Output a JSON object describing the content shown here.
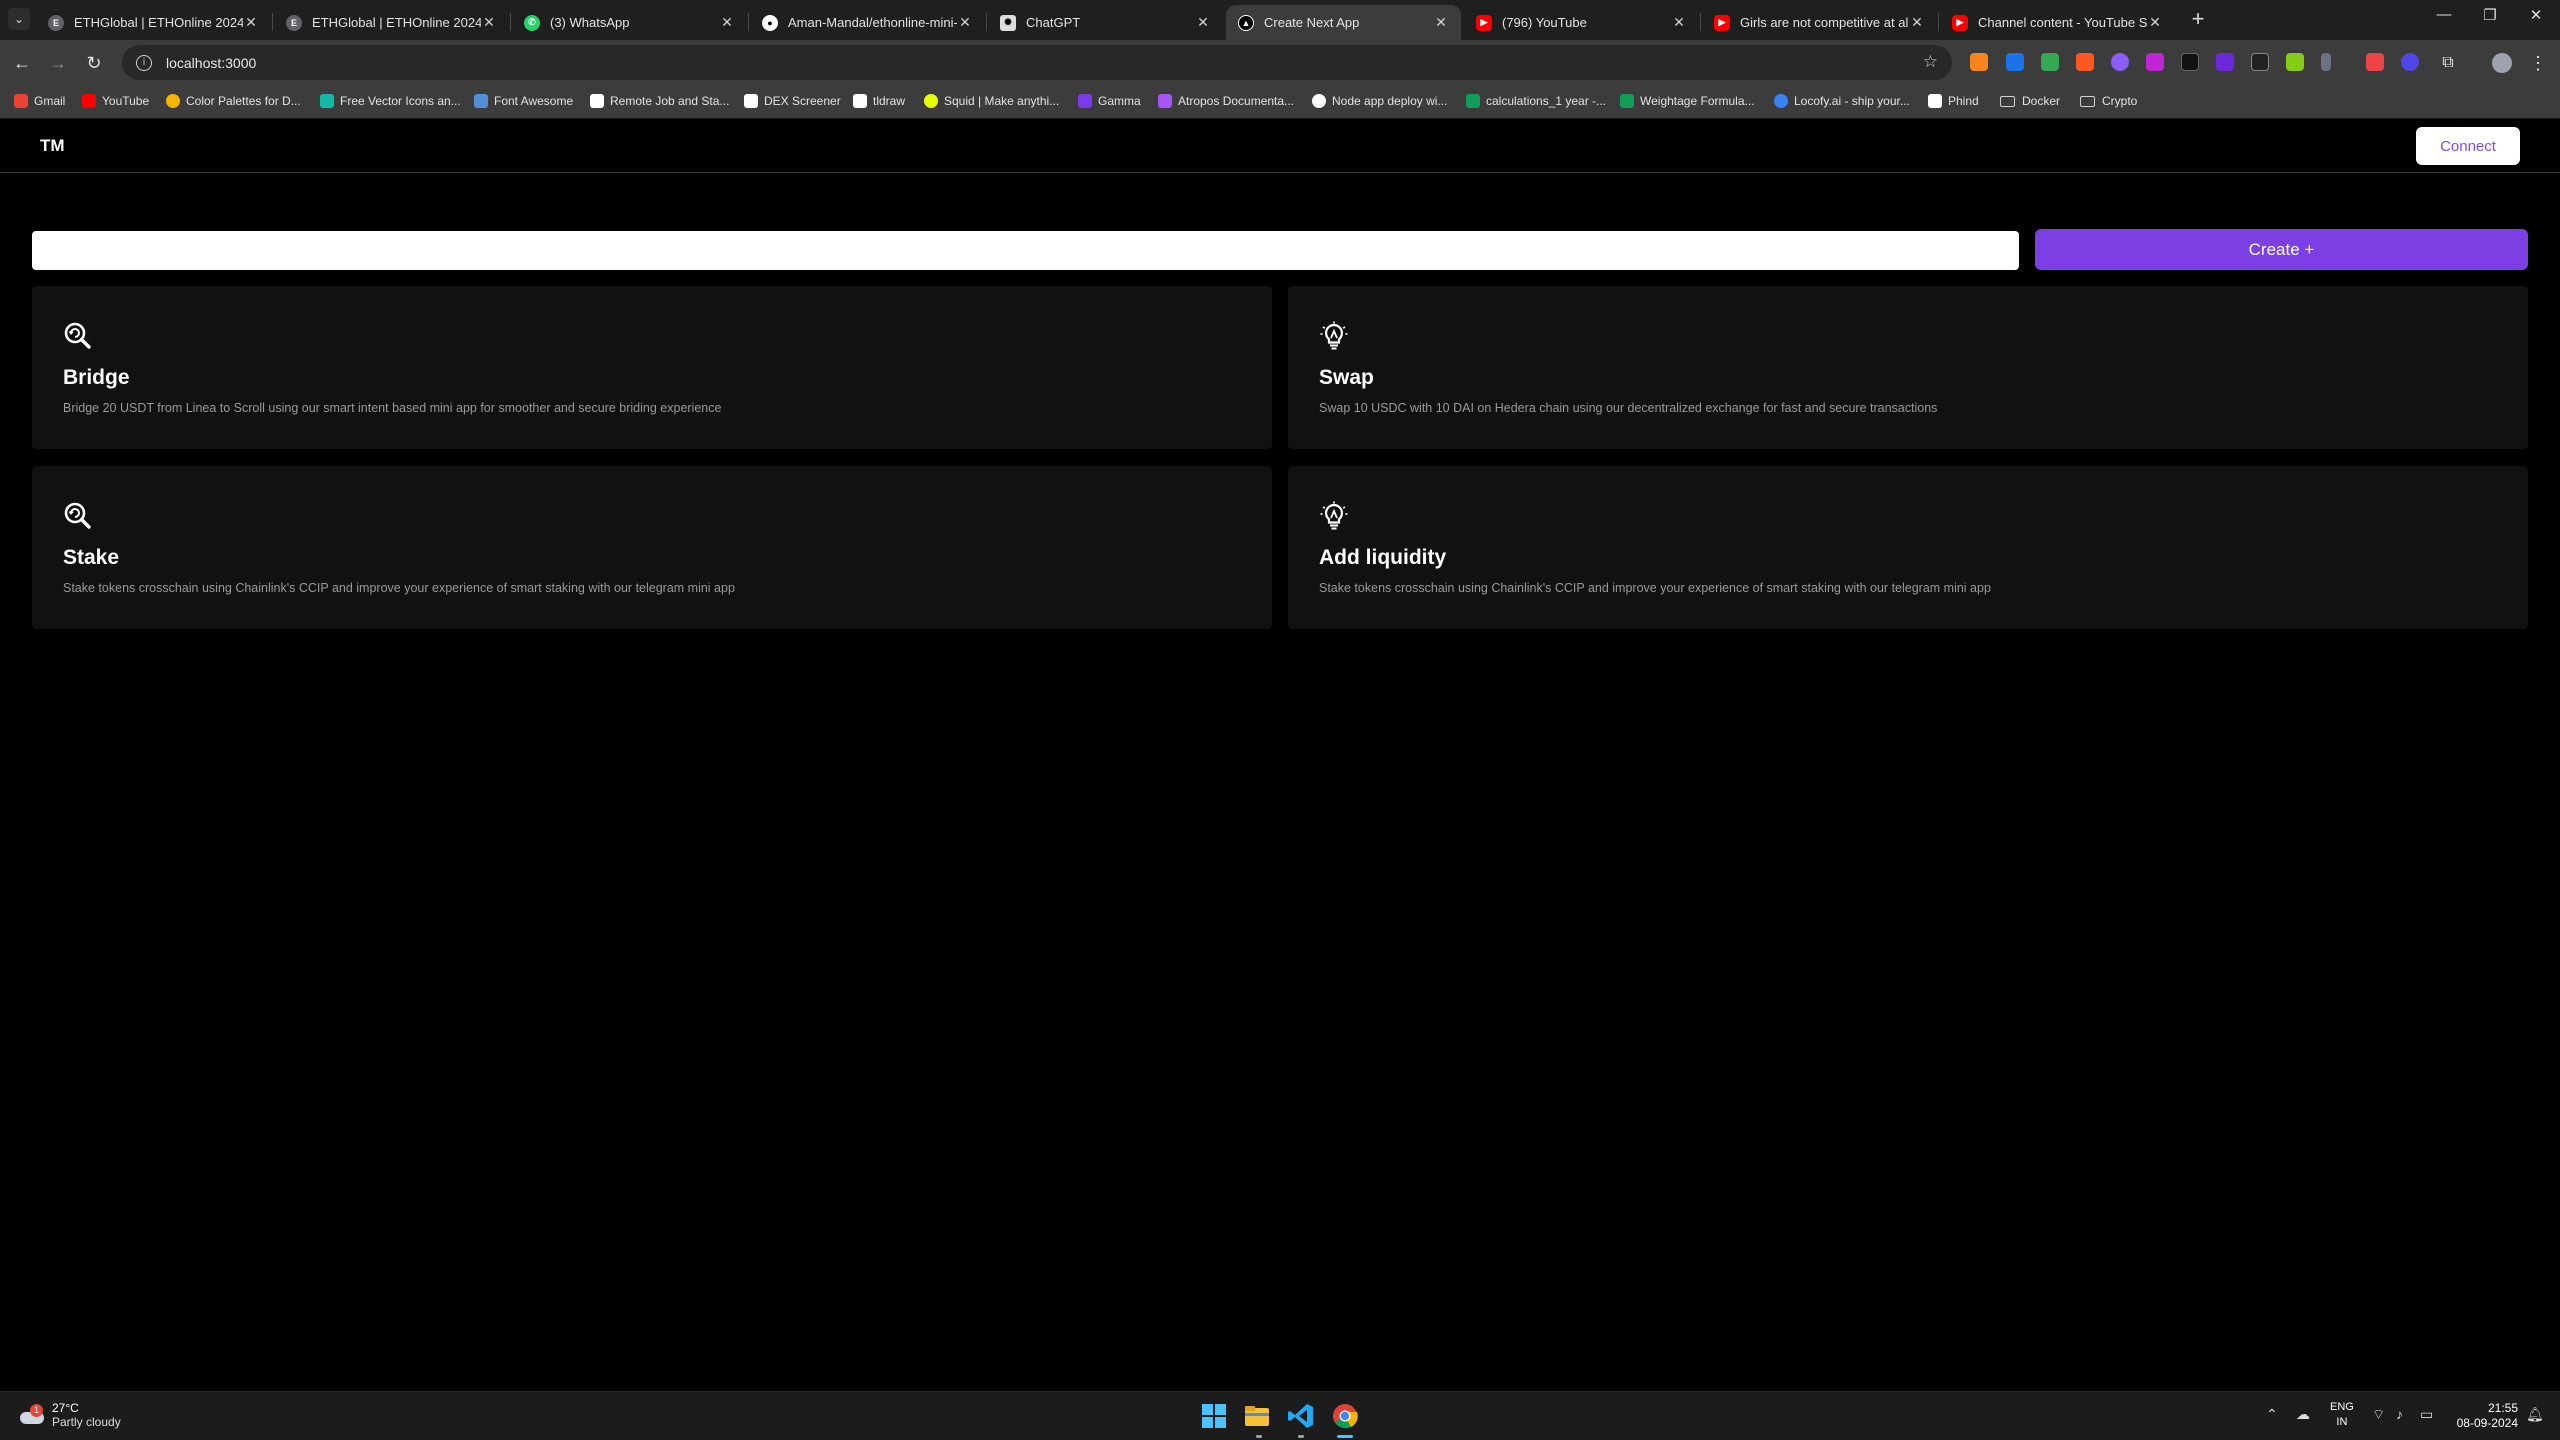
{
  "browser": {
    "tabs": [
      {
        "title": "ETHGlobal | ETHOnline 2024",
        "icon": "ethglobal-icon",
        "color": "#9aa0a6"
      },
      {
        "title": "ETHGlobal | ETHOnline 2024",
        "icon": "ethglobal-icon",
        "color": "#9aa0a6"
      },
      {
        "title": "(3) WhatsApp",
        "icon": "whatsapp-icon",
        "color": "#25d366"
      },
      {
        "title": "Aman-Mandal/ethonline-mini-a",
        "icon": "github-icon",
        "color": "#ffffff"
      },
      {
        "title": "ChatGPT",
        "icon": "chatgpt-icon",
        "color": "#dddddd"
      },
      {
        "title": "Create Next App",
        "icon": "nextjs-icon",
        "color": "#ffffff",
        "active": true
      },
      {
        "title": "(796) YouTube",
        "icon": "youtube-icon",
        "color": "#ff0000"
      },
      {
        "title": "Girls are not competitive at all...",
        "icon": "youtube-icon",
        "color": "#ff0000"
      },
      {
        "title": "Channel content - YouTube Stu",
        "icon": "youtube-studio-icon",
        "color": "#ff0000"
      }
    ],
    "url": "localhost:3000",
    "bookmarks": [
      {
        "label": "Gmail",
        "color": "#ea4335"
      },
      {
        "label": "YouTube",
        "color": "#ff0000"
      },
      {
        "label": "Color Palettes for D...",
        "color": "#f4b400"
      },
      {
        "label": "Free Vector Icons an...",
        "color": "#14b8a6"
      },
      {
        "label": "Font Awesome",
        "color": "#538dd7"
      },
      {
        "label": "Remote Job and Sta...",
        "color": "#ffffff"
      },
      {
        "label": "DEX Screener",
        "color": "#ffffff"
      },
      {
        "label": "tldraw",
        "color": "#ffffff"
      },
      {
        "label": "Squid | Make anythi...",
        "color": "#e6ff00"
      },
      {
        "label": "Gamma",
        "color": "#7c3aed"
      },
      {
        "label": "Atropos Documenta...",
        "color": "#a855f7"
      },
      {
        "label": "Node app deploy wi...",
        "color": "#ffffff"
      },
      {
        "label": "calculations_1 year -...",
        "color": "#0f9d58"
      },
      {
        "label": "Weightage Formula...",
        "color": "#0f9d58"
      },
      {
        "label": "Locofy.ai - ship your...",
        "color": "#3b82f6"
      },
      {
        "label": "Phind",
        "color": "#ffffff"
      },
      {
        "label": "Docker",
        "folder": true
      },
      {
        "label": "Crypto",
        "folder": true
      }
    ]
  },
  "app": {
    "logo": "TM",
    "connect_label": "Connect",
    "search": {
      "value": "",
      "placeholder": ""
    },
    "create_label": "Create +",
    "accent": "#7b3fe4",
    "cards": [
      {
        "title": "Bridge",
        "icon": "search-target-icon",
        "description": "Bridge 20 USDT from Linea to Scroll using our smart intent based mini app for smoother and secure briding experience"
      },
      {
        "title": "Swap",
        "icon": "lightbulb-icon",
        "description": "Swap 10 USDC with 10 DAI on Hedera chain using our decentralized exchange for fast and secure transactions"
      },
      {
        "title": "Stake",
        "icon": "search-target-icon",
        "description": "Stake tokens crosschain using Chainlink's CCIP and improve your experience of smart staking with our telegram mini app"
      },
      {
        "title": "Add liquidity",
        "icon": "lightbulb-icon",
        "description": "Stake tokens crosschain using Chainlink's CCIP and improve your experience of smart staking with our telegram mini app"
      }
    ]
  },
  "taskbar": {
    "weather_temp": "27°C",
    "weather_desc": "Partly cloudy",
    "weather_badge": "1",
    "lang_top": "ENG",
    "lang_bottom": "IN",
    "time": "21:55",
    "date": "08-09-2024"
  }
}
